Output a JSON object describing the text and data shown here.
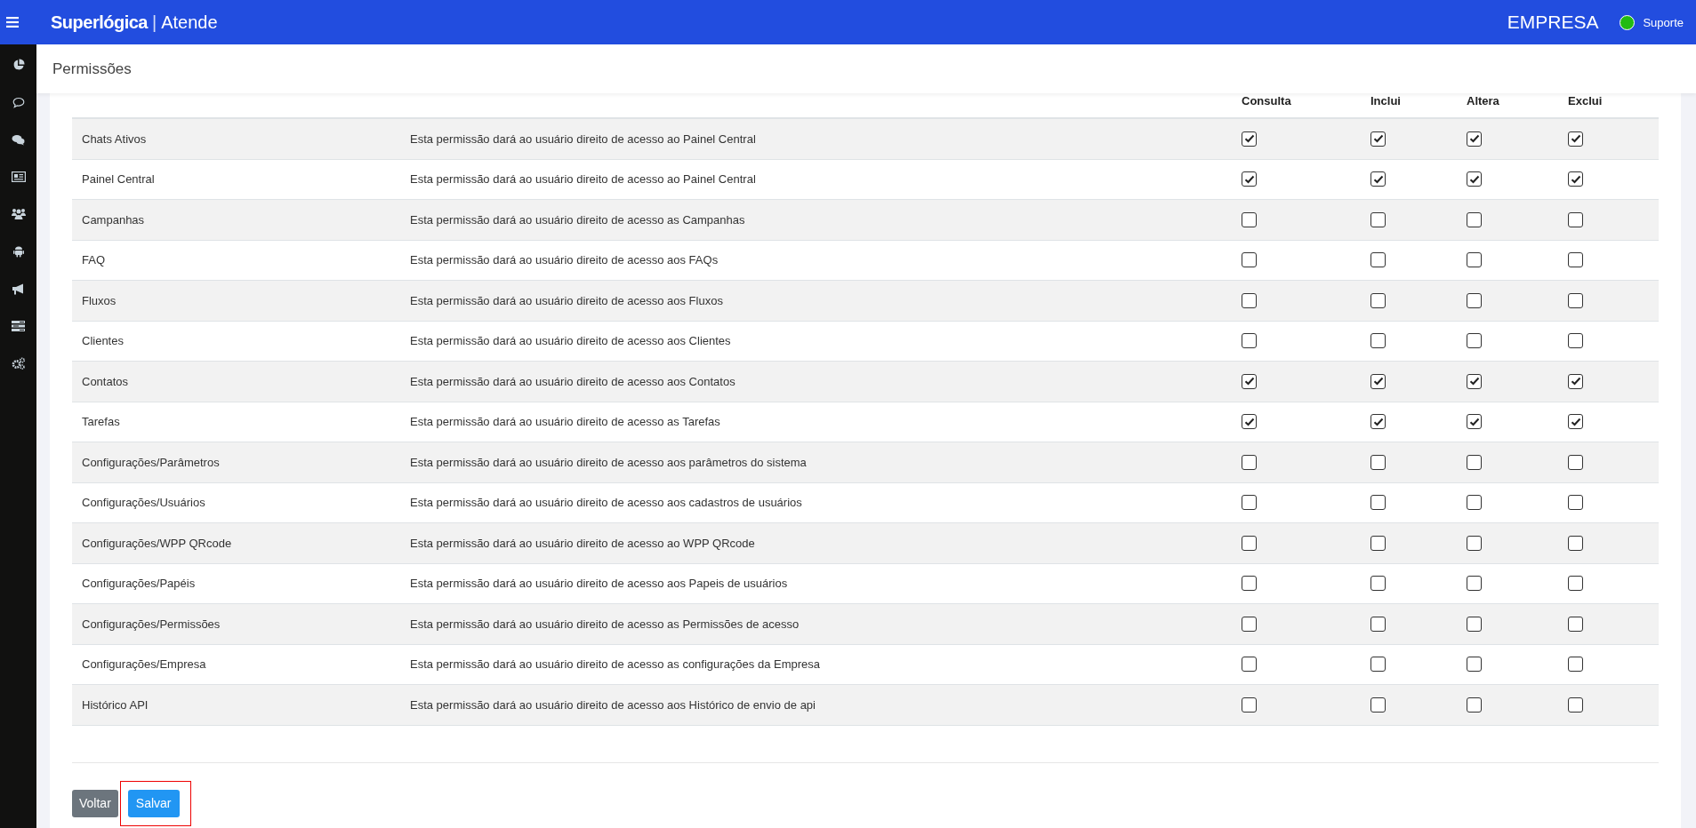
{
  "topbar": {
    "brand_bold": "Superlógica",
    "brand_separator": "|",
    "brand_light": "Atende",
    "company": "EMPRESA",
    "status": {
      "color": "#22bb11"
    },
    "user": "Suporte"
  },
  "sidebar": {
    "items": [
      {
        "kind": "chart"
      },
      {
        "kind": "chat"
      },
      {
        "kind": "chats"
      },
      {
        "kind": "news"
      },
      {
        "kind": "users"
      },
      {
        "kind": "android"
      },
      {
        "kind": "megaphone"
      },
      {
        "kind": "list"
      },
      {
        "kind": "gears"
      }
    ]
  },
  "page": {
    "title": "Permissões"
  },
  "table": {
    "columns": [
      "Consulta",
      "Inclui",
      "Altera",
      "Exclui"
    ],
    "rows": [
      {
        "name": "Chats Ativos",
        "description": "Esta permissão dará ao usuário direito de acesso ao Painel Central",
        "checks": [
          true,
          true,
          true,
          true
        ]
      },
      {
        "name": "Painel Central",
        "description": "Esta permissão dará ao usuário direito de acesso ao Painel Central",
        "checks": [
          true,
          true,
          true,
          true
        ]
      },
      {
        "name": "Campanhas",
        "description": "Esta permissão dará ao usuário direito de acesso as Campanhas",
        "checks": [
          false,
          false,
          false,
          false
        ]
      },
      {
        "name": "FAQ",
        "description": "Esta permissão dará ao usuário direito de acesso aos FAQs",
        "checks": [
          false,
          false,
          false,
          false
        ]
      },
      {
        "name": "Fluxos",
        "description": "Esta permissão dará ao usuário direito de acesso aos Fluxos",
        "checks": [
          false,
          false,
          false,
          false
        ]
      },
      {
        "name": "Clientes",
        "description": "Esta permissão dará ao usuário direito de acesso aos Clientes",
        "checks": [
          false,
          false,
          false,
          false
        ]
      },
      {
        "name": "Contatos",
        "description": "Esta permissão dará ao usuário direito de acesso aos Contatos",
        "checks": [
          true,
          true,
          true,
          true
        ]
      },
      {
        "name": "Tarefas",
        "description": "Esta permissão dará ao usuário direito de acesso as Tarefas",
        "checks": [
          true,
          true,
          true,
          true
        ]
      },
      {
        "name": "Configurações/Parâmetros",
        "description": "Esta permissão dará ao usuário direito de acesso aos parâmetros do sistema",
        "checks": [
          false,
          false,
          false,
          false
        ]
      },
      {
        "name": "Configurações/Usuários",
        "description": "Esta permissão dará ao usuário direito de acesso aos cadastros de usuários",
        "checks": [
          false,
          false,
          false,
          false
        ]
      },
      {
        "name": "Configurações/WPP QRcode",
        "description": "Esta permissão dará ao usuário direito de acesso ao WPP QRcode",
        "checks": [
          false,
          false,
          false,
          false
        ]
      },
      {
        "name": "Configurações/Papéis",
        "description": "Esta permissão dará ao usuário direito de acesso aos Papeis de usuários",
        "checks": [
          false,
          false,
          false,
          false
        ]
      },
      {
        "name": "Configurações/Permissões",
        "description": "Esta permissão dará ao usuário direito de acesso as Permissões de acesso",
        "checks": [
          false,
          false,
          false,
          false
        ]
      },
      {
        "name": "Configurações/Empresa",
        "description": "Esta permissão dará ao usuário direito de acesso as configurações da Empresa",
        "checks": [
          false,
          false,
          false,
          false
        ]
      },
      {
        "name": "Histórico API",
        "description": "Esta permissão dará ao usuário direito de acesso aos Histórico de envio de api",
        "checks": [
          false,
          false,
          false,
          false
        ]
      }
    ]
  },
  "buttons": [
    {
      "kind": "secondary",
      "label": "Voltar",
      "highlighted": false
    },
    {
      "kind": "primary",
      "label": "Salvar",
      "highlighted": true
    }
  ]
}
